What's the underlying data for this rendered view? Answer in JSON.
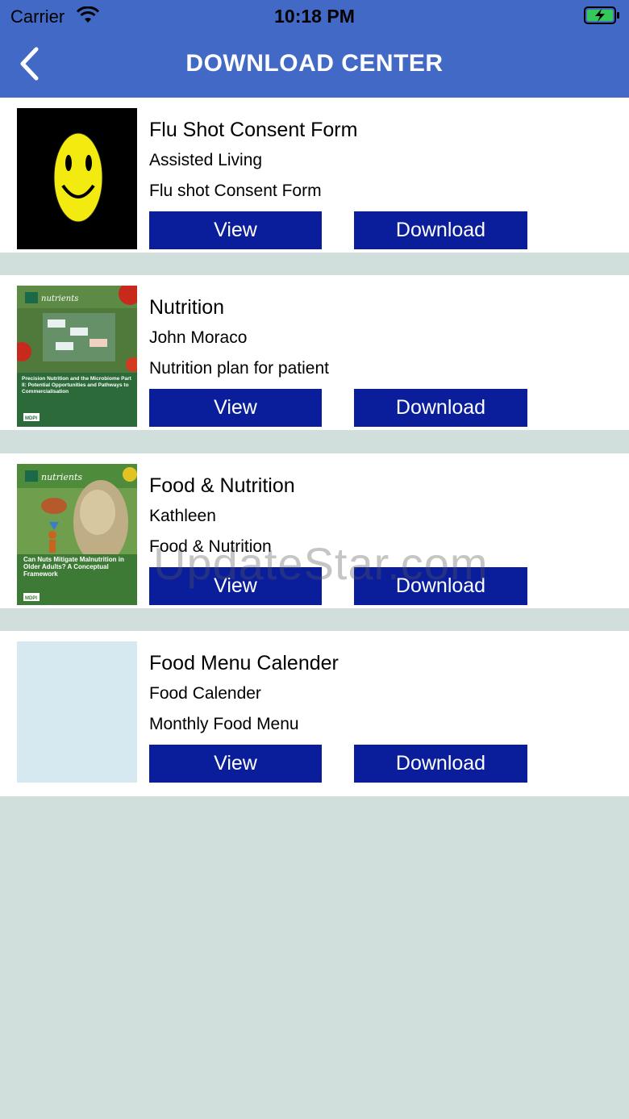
{
  "status_bar": {
    "carrier": "Carrier",
    "time": "10:18 PM"
  },
  "header": {
    "title": "DOWNLOAD CENTER",
    "back_icon": "chevron-left-icon"
  },
  "items": [
    {
      "title": "Flu Shot Consent Form",
      "subtitle": "Assisted Living",
      "description": "Flu shot Consent Form",
      "view_label": "View",
      "download_label": "Download"
    },
    {
      "title": "Nutrition",
      "subtitle": "John Moraco",
      "description": "Nutrition plan for patient",
      "view_label": "View",
      "download_label": "Download",
      "thumb": {
        "journal": "nutrients",
        "cover_title": "Precision Nutrition and the Microbiome Part II: Potential Opportunities and Pathways to Commercialisation",
        "publisher": "MDPI"
      }
    },
    {
      "title": "Food & Nutrition",
      "subtitle": "Kathleen",
      "description": "Food & Nutrition",
      "view_label": "View",
      "download_label": "Download",
      "thumb": {
        "journal": "nutrients",
        "cover_title": "Can Nuts Mitigate Malnutrition in Older Adults? A Conceptual Framework",
        "publisher": "MDPI"
      }
    },
    {
      "title": "Food Menu Calender",
      "subtitle": "Food Calender",
      "description": "Monthly Food Menu",
      "view_label": "View",
      "download_label": "Download"
    }
  ],
  "watermark": "UpdateStar.com",
  "colors": {
    "header": "#4169c5",
    "button": "#0a1e9c",
    "background": "#d0dedc"
  }
}
